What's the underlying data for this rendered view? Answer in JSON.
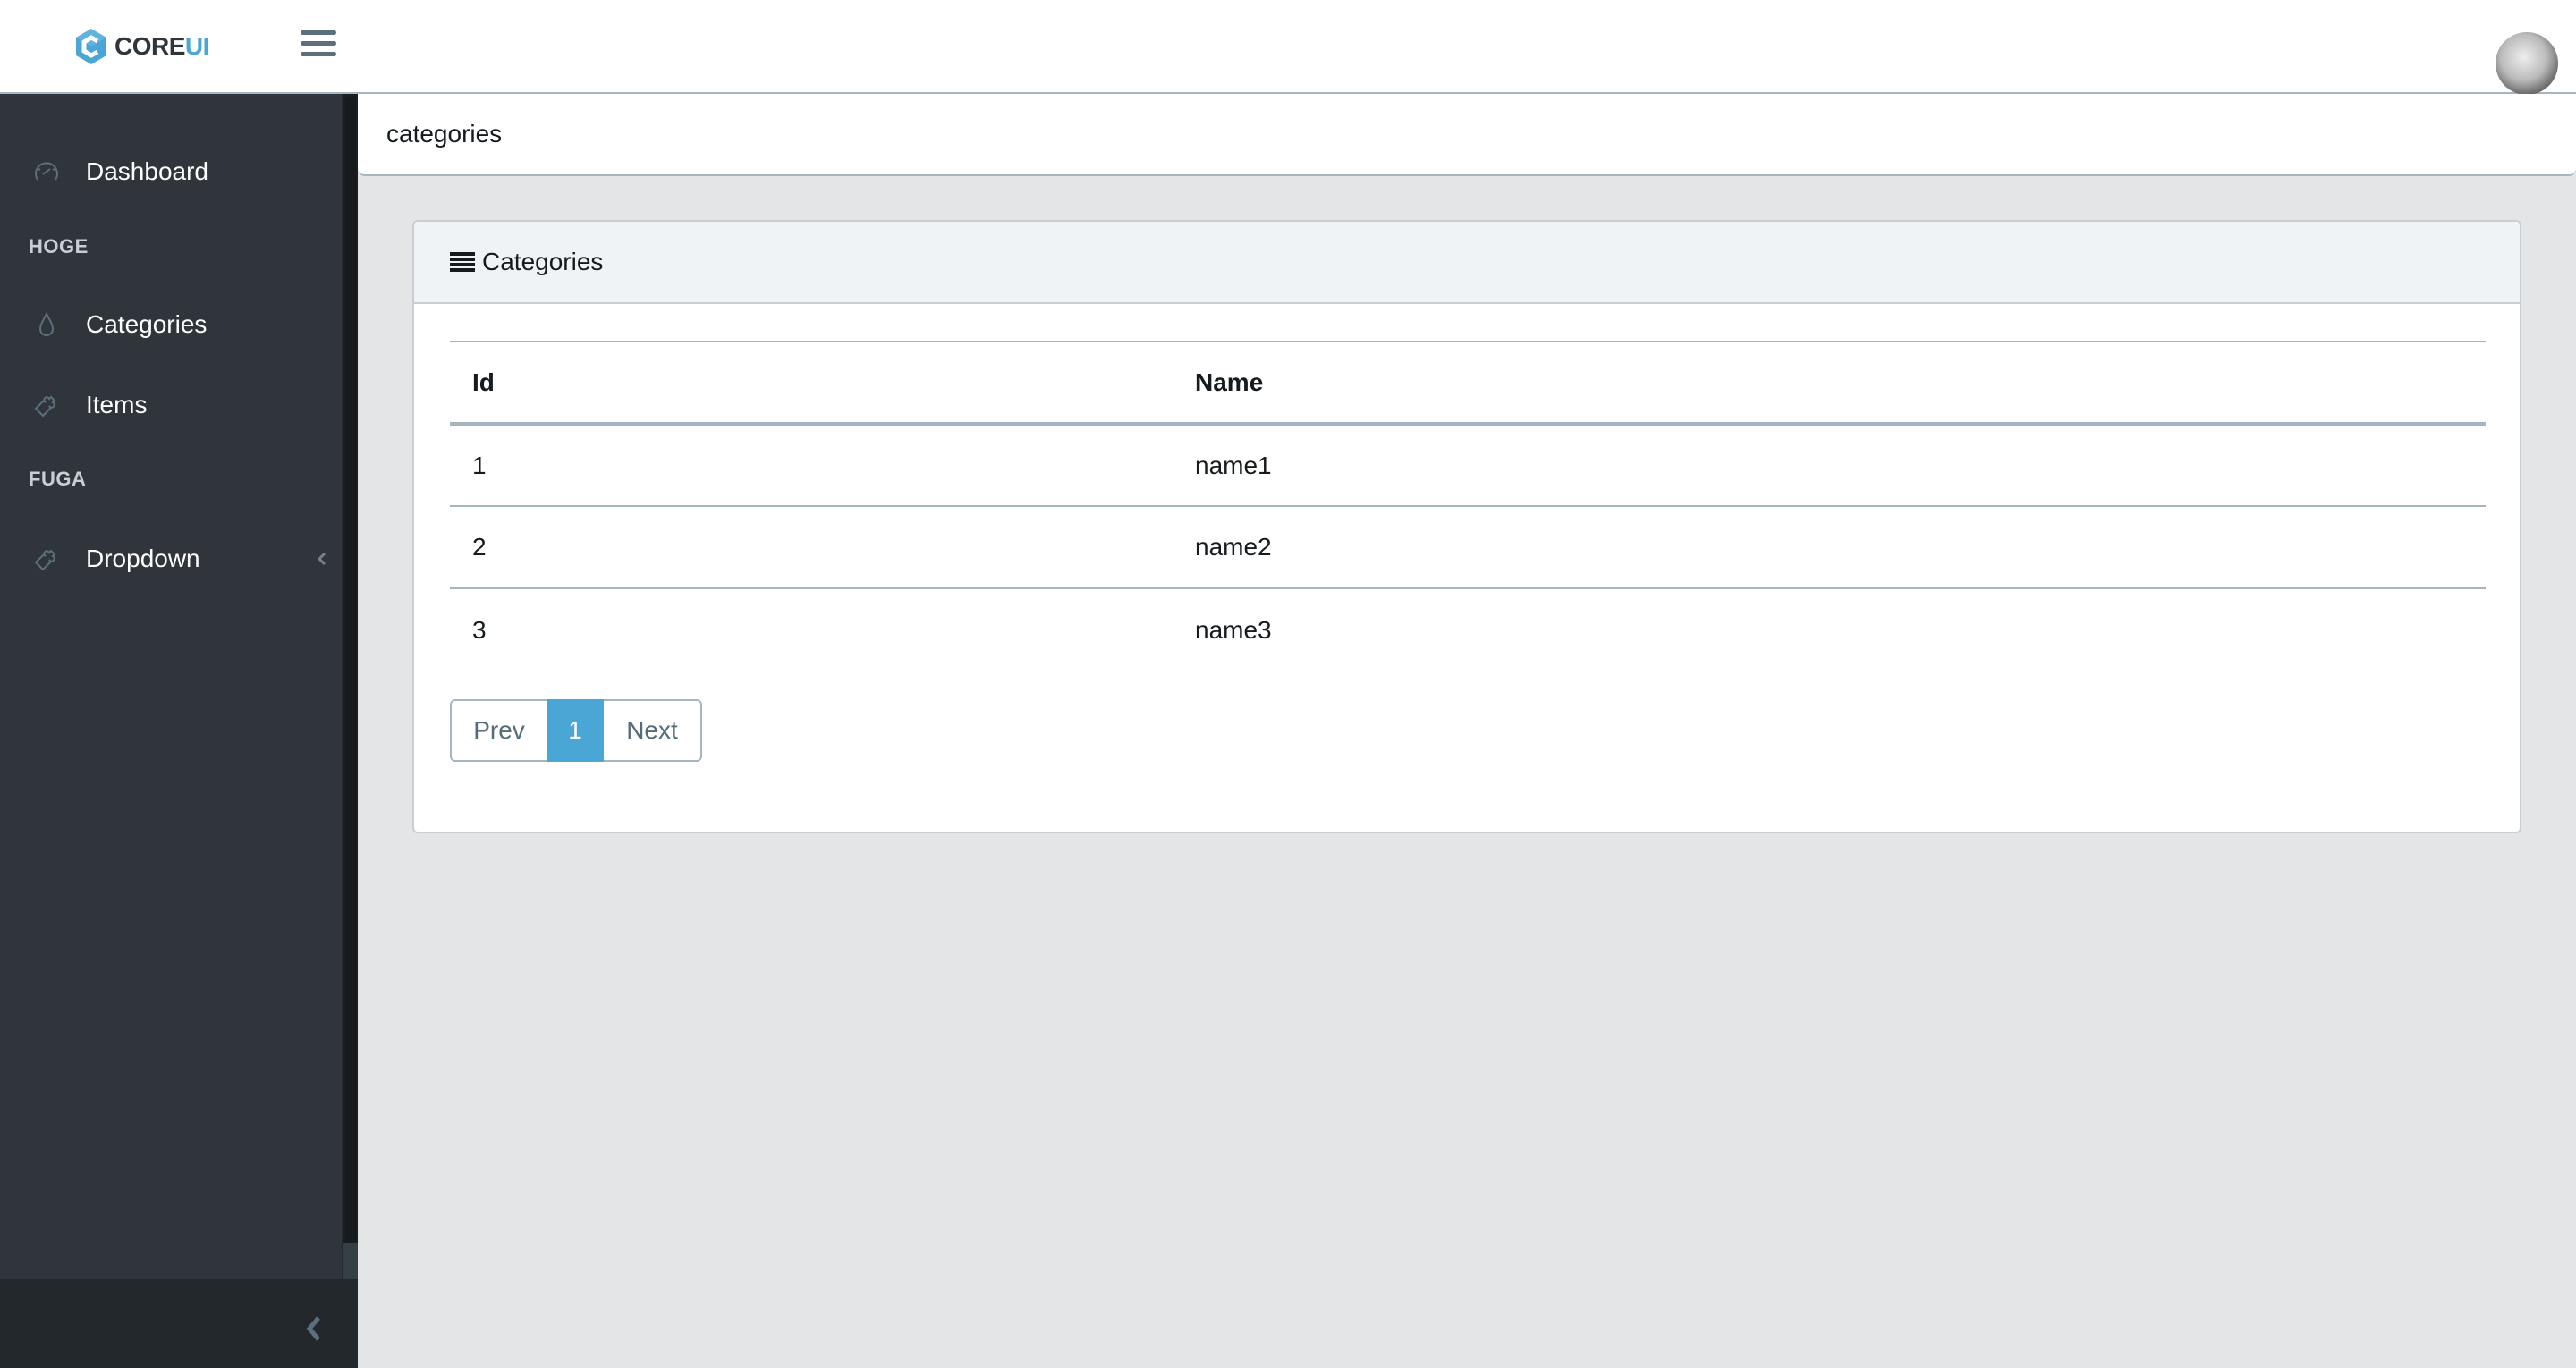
{
  "header": {
    "brand_core": "CORE",
    "brand_ui": "UI",
    "toggler_icon": "hamburger-menu-icon",
    "avatar_icon": "user-avatar"
  },
  "sidebar": {
    "items": [
      {
        "type": "link",
        "label": "Dashboard",
        "icon": "speedometer-icon"
      },
      {
        "type": "title",
        "label": "HOGE"
      },
      {
        "type": "link",
        "label": "Categories",
        "icon": "drop-icon"
      },
      {
        "type": "link",
        "label": "Items",
        "icon": "puzzle-icon"
      },
      {
        "type": "title",
        "label": "FUGA"
      },
      {
        "type": "dropdown",
        "label": "Dropdown",
        "icon": "puzzle-icon",
        "caret_icon": "chevron-left-icon"
      }
    ],
    "minimizer_icon": "chevron-left-icon"
  },
  "breadcrumb": {
    "current": "categories"
  },
  "card": {
    "title": "Categories",
    "icon": "list-icon",
    "table": {
      "columns": [
        "Id",
        "Name"
      ],
      "rows": [
        {
          "id": "1",
          "name": "name1"
        },
        {
          "id": "2",
          "name": "name2"
        },
        {
          "id": "3",
          "name": "name3"
        }
      ]
    },
    "pagination": {
      "prev_label": "Prev",
      "pages": [
        "1"
      ],
      "active_page": "1",
      "next_label": "Next"
    }
  },
  "colors": {
    "accent": "#4aa6d5",
    "sidebar_bg": "#2f353a",
    "sidebar_footer_bg": "#23282c",
    "body_bg": "#e4e5e6",
    "border": "#a4b7c1"
  }
}
